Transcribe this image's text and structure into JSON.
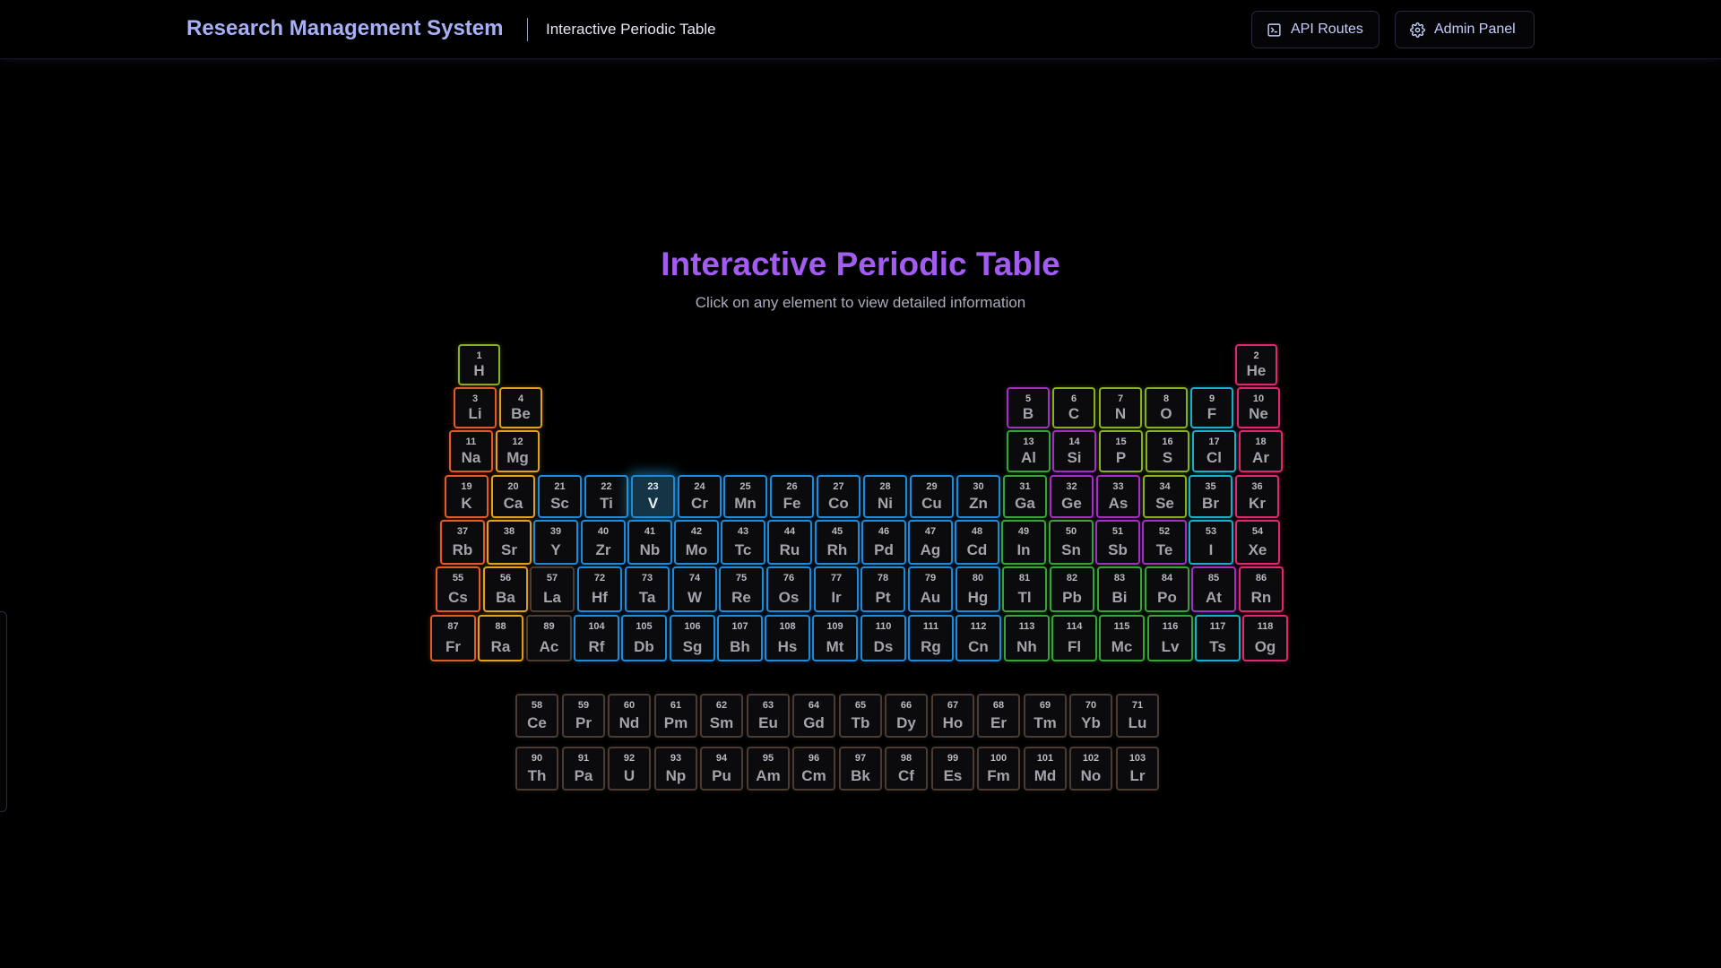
{
  "header": {
    "app_title": "Research Management System",
    "page_name": "Interactive Periodic Table",
    "api_button": "API Routes",
    "admin_button": "Admin Panel"
  },
  "main": {
    "title": "Interactive Periodic Table",
    "hint": "Click on any element to view detailed information"
  },
  "selected_element": 23,
  "category_colors": {
    "alkali": "#e05a2a",
    "alkaline": "#e0a21a",
    "transition": "#1f8ad8",
    "lanthanide": "#4a3c34",
    "actinide": "#4a3c34",
    "post_transition": "#3aa23a",
    "metalloid": "#a030c0",
    "nonmetal": "#88b020",
    "halogen": "#18b0c8",
    "noble": "#e0286e",
    "unknown": "#1f8ad8"
  },
  "elements": [
    {
      "n": 1,
      "s": "H",
      "row": 1,
      "col": 1,
      "cat": "nonmetal"
    },
    {
      "n": 2,
      "s": "He",
      "row": 1,
      "col": 18,
      "cat": "noble"
    },
    {
      "n": 3,
      "s": "Li",
      "row": 2,
      "col": 1,
      "cat": "alkali"
    },
    {
      "n": 4,
      "s": "Be",
      "row": 2,
      "col": 2,
      "cat": "alkaline"
    },
    {
      "n": 5,
      "s": "B",
      "row": 2,
      "col": 13,
      "cat": "metalloid"
    },
    {
      "n": 6,
      "s": "C",
      "row": 2,
      "col": 14,
      "cat": "nonmetal"
    },
    {
      "n": 7,
      "s": "N",
      "row": 2,
      "col": 15,
      "cat": "nonmetal"
    },
    {
      "n": 8,
      "s": "O",
      "row": 2,
      "col": 16,
      "cat": "nonmetal"
    },
    {
      "n": 9,
      "s": "F",
      "row": 2,
      "col": 17,
      "cat": "halogen"
    },
    {
      "n": 10,
      "s": "Ne",
      "row": 2,
      "col": 18,
      "cat": "noble"
    },
    {
      "n": 11,
      "s": "Na",
      "row": 3,
      "col": 1,
      "cat": "alkali"
    },
    {
      "n": 12,
      "s": "Mg",
      "row": 3,
      "col": 2,
      "cat": "alkaline"
    },
    {
      "n": 13,
      "s": "Al",
      "row": 3,
      "col": 13,
      "cat": "post_transition"
    },
    {
      "n": 14,
      "s": "Si",
      "row": 3,
      "col": 14,
      "cat": "metalloid"
    },
    {
      "n": 15,
      "s": "P",
      "row": 3,
      "col": 15,
      "cat": "nonmetal"
    },
    {
      "n": 16,
      "s": "S",
      "row": 3,
      "col": 16,
      "cat": "nonmetal"
    },
    {
      "n": 17,
      "s": "Cl",
      "row": 3,
      "col": 17,
      "cat": "halogen"
    },
    {
      "n": 18,
      "s": "Ar",
      "row": 3,
      "col": 18,
      "cat": "noble"
    },
    {
      "n": 19,
      "s": "K",
      "row": 4,
      "col": 1,
      "cat": "alkali"
    },
    {
      "n": 20,
      "s": "Ca",
      "row": 4,
      "col": 2,
      "cat": "alkaline"
    },
    {
      "n": 21,
      "s": "Sc",
      "row": 4,
      "col": 3,
      "cat": "transition"
    },
    {
      "n": 22,
      "s": "Ti",
      "row": 4,
      "col": 4,
      "cat": "transition"
    },
    {
      "n": 23,
      "s": "V",
      "row": 4,
      "col": 5,
      "cat": "transition"
    },
    {
      "n": 24,
      "s": "Cr",
      "row": 4,
      "col": 6,
      "cat": "transition"
    },
    {
      "n": 25,
      "s": "Mn",
      "row": 4,
      "col": 7,
      "cat": "transition"
    },
    {
      "n": 26,
      "s": "Fe",
      "row": 4,
      "col": 8,
      "cat": "transition"
    },
    {
      "n": 27,
      "s": "Co",
      "row": 4,
      "col": 9,
      "cat": "transition"
    },
    {
      "n": 28,
      "s": "Ni",
      "row": 4,
      "col": 10,
      "cat": "transition"
    },
    {
      "n": 29,
      "s": "Cu",
      "row": 4,
      "col": 11,
      "cat": "transition"
    },
    {
      "n": 30,
      "s": "Zn",
      "row": 4,
      "col": 12,
      "cat": "transition"
    },
    {
      "n": 31,
      "s": "Ga",
      "row": 4,
      "col": 13,
      "cat": "post_transition"
    },
    {
      "n": 32,
      "s": "Ge",
      "row": 4,
      "col": 14,
      "cat": "metalloid"
    },
    {
      "n": 33,
      "s": "As",
      "row": 4,
      "col": 15,
      "cat": "metalloid"
    },
    {
      "n": 34,
      "s": "Se",
      "row": 4,
      "col": 16,
      "cat": "nonmetal"
    },
    {
      "n": 35,
      "s": "Br",
      "row": 4,
      "col": 17,
      "cat": "halogen"
    },
    {
      "n": 36,
      "s": "Kr",
      "row": 4,
      "col": 18,
      "cat": "noble"
    },
    {
      "n": 37,
      "s": "Rb",
      "row": 5,
      "col": 1,
      "cat": "alkali"
    },
    {
      "n": 38,
      "s": "Sr",
      "row": 5,
      "col": 2,
      "cat": "alkaline"
    },
    {
      "n": 39,
      "s": "Y",
      "row": 5,
      "col": 3,
      "cat": "transition"
    },
    {
      "n": 40,
      "s": "Zr",
      "row": 5,
      "col": 4,
      "cat": "transition"
    },
    {
      "n": 41,
      "s": "Nb",
      "row": 5,
      "col": 5,
      "cat": "transition"
    },
    {
      "n": 42,
      "s": "Mo",
      "row": 5,
      "col": 6,
      "cat": "transition"
    },
    {
      "n": 43,
      "s": "Tc",
      "row": 5,
      "col": 7,
      "cat": "transition"
    },
    {
      "n": 44,
      "s": "Ru",
      "row": 5,
      "col": 8,
      "cat": "transition"
    },
    {
      "n": 45,
      "s": "Rh",
      "row": 5,
      "col": 9,
      "cat": "transition"
    },
    {
      "n": 46,
      "s": "Pd",
      "row": 5,
      "col": 10,
      "cat": "transition"
    },
    {
      "n": 47,
      "s": "Ag",
      "row": 5,
      "col": 11,
      "cat": "transition"
    },
    {
      "n": 48,
      "s": "Cd",
      "row": 5,
      "col": 12,
      "cat": "transition"
    },
    {
      "n": 49,
      "s": "In",
      "row": 5,
      "col": 13,
      "cat": "post_transition"
    },
    {
      "n": 50,
      "s": "Sn",
      "row": 5,
      "col": 14,
      "cat": "post_transition"
    },
    {
      "n": 51,
      "s": "Sb",
      "row": 5,
      "col": 15,
      "cat": "metalloid"
    },
    {
      "n": 52,
      "s": "Te",
      "row": 5,
      "col": 16,
      "cat": "metalloid"
    },
    {
      "n": 53,
      "s": "I",
      "row": 5,
      "col": 17,
      "cat": "halogen"
    },
    {
      "n": 54,
      "s": "Xe",
      "row": 5,
      "col": 18,
      "cat": "noble"
    },
    {
      "n": 55,
      "s": "Cs",
      "row": 6,
      "col": 1,
      "cat": "alkali"
    },
    {
      "n": 56,
      "s": "Ba",
      "row": 6,
      "col": 2,
      "cat": "alkaline"
    },
    {
      "n": 57,
      "s": "La",
      "row": 6,
      "col": 3,
      "cat": "lanthanide"
    },
    {
      "n": 72,
      "s": "Hf",
      "row": 6,
      "col": 4,
      "cat": "transition"
    },
    {
      "n": 73,
      "s": "Ta",
      "row": 6,
      "col": 5,
      "cat": "transition"
    },
    {
      "n": 74,
      "s": "W",
      "row": 6,
      "col": 6,
      "cat": "transition"
    },
    {
      "n": 75,
      "s": "Re",
      "row": 6,
      "col": 7,
      "cat": "transition"
    },
    {
      "n": 76,
      "s": "Os",
      "row": 6,
      "col": 8,
      "cat": "transition"
    },
    {
      "n": 77,
      "s": "Ir",
      "row": 6,
      "col": 9,
      "cat": "transition"
    },
    {
      "n": 78,
      "s": "Pt",
      "row": 6,
      "col": 10,
      "cat": "transition"
    },
    {
      "n": 79,
      "s": "Au",
      "row": 6,
      "col": 11,
      "cat": "transition"
    },
    {
      "n": 80,
      "s": "Hg",
      "row": 6,
      "col": 12,
      "cat": "transition"
    },
    {
      "n": 81,
      "s": "Tl",
      "row": 6,
      "col": 13,
      "cat": "post_transition"
    },
    {
      "n": 82,
      "s": "Pb",
      "row": 6,
      "col": 14,
      "cat": "post_transition"
    },
    {
      "n": 83,
      "s": "Bi",
      "row": 6,
      "col": 15,
      "cat": "post_transition"
    },
    {
      "n": 84,
      "s": "Po",
      "row": 6,
      "col": 16,
      "cat": "post_transition"
    },
    {
      "n": 85,
      "s": "At",
      "row": 6,
      "col": 17,
      "cat": "metalloid"
    },
    {
      "n": 86,
      "s": "Rn",
      "row": 6,
      "col": 18,
      "cat": "noble"
    },
    {
      "n": 87,
      "s": "Fr",
      "row": 7,
      "col": 1,
      "cat": "alkali"
    },
    {
      "n": 88,
      "s": "Ra",
      "row": 7,
      "col": 2,
      "cat": "alkaline"
    },
    {
      "n": 89,
      "s": "Ac",
      "row": 7,
      "col": 3,
      "cat": "actinide"
    },
    {
      "n": 104,
      "s": "Rf",
      "row": 7,
      "col": 4,
      "cat": "transition"
    },
    {
      "n": 105,
      "s": "Db",
      "row": 7,
      "col": 5,
      "cat": "transition"
    },
    {
      "n": 106,
      "s": "Sg",
      "row": 7,
      "col": 6,
      "cat": "transition"
    },
    {
      "n": 107,
      "s": "Bh",
      "row": 7,
      "col": 7,
      "cat": "transition"
    },
    {
      "n": 108,
      "s": "Hs",
      "row": 7,
      "col": 8,
      "cat": "transition"
    },
    {
      "n": 109,
      "s": "Mt",
      "row": 7,
      "col": 9,
      "cat": "transition"
    },
    {
      "n": 110,
      "s": "Ds",
      "row": 7,
      "col": 10,
      "cat": "transition"
    },
    {
      "n": 111,
      "s": "Rg",
      "row": 7,
      "col": 11,
      "cat": "transition"
    },
    {
      "n": 112,
      "s": "Cn",
      "row": 7,
      "col": 12,
      "cat": "transition"
    },
    {
      "n": 113,
      "s": "Nh",
      "row": 7,
      "col": 13,
      "cat": "post_transition"
    },
    {
      "n": 114,
      "s": "Fl",
      "row": 7,
      "col": 14,
      "cat": "post_transition"
    },
    {
      "n": 115,
      "s": "Mc",
      "row": 7,
      "col": 15,
      "cat": "post_transition"
    },
    {
      "n": 116,
      "s": "Lv",
      "row": 7,
      "col": 16,
      "cat": "post_transition"
    },
    {
      "n": 117,
      "s": "Ts",
      "row": 7,
      "col": 17,
      "cat": "halogen"
    },
    {
      "n": 118,
      "s": "Og",
      "row": 7,
      "col": 18,
      "cat": "noble"
    },
    {
      "n": 58,
      "s": "Ce",
      "row": 9,
      "col": 4,
      "cat": "lanthanide"
    },
    {
      "n": 59,
      "s": "Pr",
      "row": 9,
      "col": 5,
      "cat": "lanthanide"
    },
    {
      "n": 60,
      "s": "Nd",
      "row": 9,
      "col": 6,
      "cat": "lanthanide"
    },
    {
      "n": 61,
      "s": "Pm",
      "row": 9,
      "col": 7,
      "cat": "lanthanide"
    },
    {
      "n": 62,
      "s": "Sm",
      "row": 9,
      "col": 8,
      "cat": "lanthanide"
    },
    {
      "n": 63,
      "s": "Eu",
      "row": 9,
      "col": 9,
      "cat": "lanthanide"
    },
    {
      "n": 64,
      "s": "Gd",
      "row": 9,
      "col": 10,
      "cat": "lanthanide"
    },
    {
      "n": 65,
      "s": "Tb",
      "row": 9,
      "col": 11,
      "cat": "lanthanide"
    },
    {
      "n": 66,
      "s": "Dy",
      "row": 9,
      "col": 12,
      "cat": "lanthanide"
    },
    {
      "n": 67,
      "s": "Ho",
      "row": 9,
      "col": 13,
      "cat": "lanthanide"
    },
    {
      "n": 68,
      "s": "Er",
      "row": 9,
      "col": 14,
      "cat": "lanthanide"
    },
    {
      "n": 69,
      "s": "Tm",
      "row": 9,
      "col": 15,
      "cat": "lanthanide"
    },
    {
      "n": 70,
      "s": "Yb",
      "row": 9,
      "col": 16,
      "cat": "lanthanide"
    },
    {
      "n": 71,
      "s": "Lu",
      "row": 9,
      "col": 17,
      "cat": "lanthanide"
    },
    {
      "n": 90,
      "s": "Th",
      "row": 10,
      "col": 4,
      "cat": "actinide"
    },
    {
      "n": 91,
      "s": "Pa",
      "row": 10,
      "col": 5,
      "cat": "actinide"
    },
    {
      "n": 92,
      "s": "U",
      "row": 10,
      "col": 6,
      "cat": "actinide"
    },
    {
      "n": 93,
      "s": "Np",
      "row": 10,
      "col": 7,
      "cat": "actinide"
    },
    {
      "n": 94,
      "s": "Pu",
      "row": 10,
      "col": 8,
      "cat": "actinide"
    },
    {
      "n": 95,
      "s": "Am",
      "row": 10,
      "col": 9,
      "cat": "actinide"
    },
    {
      "n": 96,
      "s": "Cm",
      "row": 10,
      "col": 10,
      "cat": "actinide"
    },
    {
      "n": 97,
      "s": "Bk",
      "row": 10,
      "col": 11,
      "cat": "actinide"
    },
    {
      "n": 98,
      "s": "Cf",
      "row": 10,
      "col": 12,
      "cat": "actinide"
    },
    {
      "n": 99,
      "s": "Es",
      "row": 10,
      "col": 13,
      "cat": "actinide"
    },
    {
      "n": 100,
      "s": "Fm",
      "row": 10,
      "col": 14,
      "cat": "actinide"
    },
    {
      "n": 101,
      "s": "Md",
      "row": 10,
      "col": 15,
      "cat": "actinide"
    },
    {
      "n": 102,
      "s": "No",
      "row": 10,
      "col": 16,
      "cat": "actinide"
    },
    {
      "n": 103,
      "s": "Lr",
      "row": 10,
      "col": 17,
      "cat": "actinide"
    }
  ]
}
